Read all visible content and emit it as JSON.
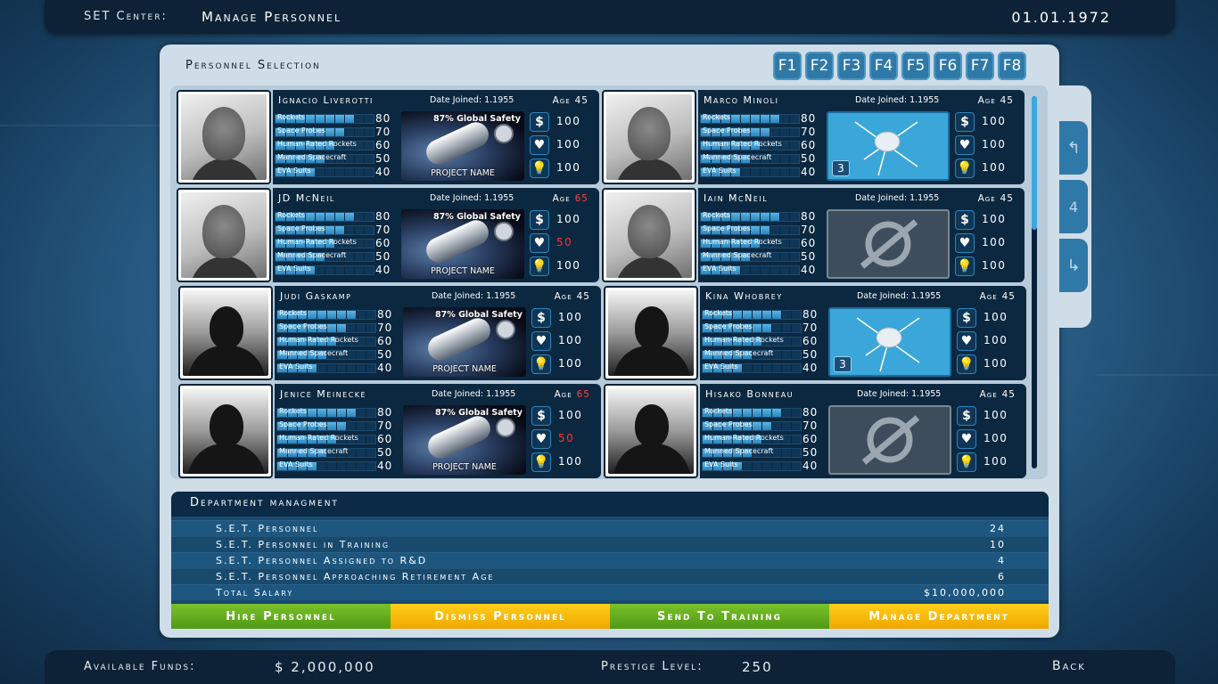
{
  "topbar": {
    "label": "SET Center:",
    "title": "Manage Personnel",
    "date": "01.01.1972"
  },
  "panel": {
    "title": "Personnel Selection",
    "fkeys": [
      "F1",
      "F2",
      "F3",
      "F4",
      "F5",
      "F6",
      "F7",
      "F8"
    ]
  },
  "pager": {
    "up": "↰",
    "page": "4",
    "down": "↳"
  },
  "skill_labels": [
    "Rockets",
    "Space Probes",
    "Human-Rated Rockets",
    "Manned Spacecraft",
    "EVA Suits"
  ],
  "date_label": "Date Joined:",
  "age_label": "Age",
  "personnel": [
    {
      "name": "Ignacio Liverotti",
      "date_joined": "1.1955",
      "age": "45",
      "age_alert": false,
      "photo": "real",
      "skills": [
        {
          "label": "Rockets",
          "value": "80",
          "level": 0.8
        },
        {
          "label": "Space Probes",
          "value": "70",
          "level": 0.7
        },
        {
          "label": "Human-Rated Rockets",
          "value": "60",
          "level": 0.6
        },
        {
          "label": "Manned Spacecraft",
          "value": "50",
          "level": 0.5
        },
        {
          "label": "EVA Suits",
          "value": "40",
          "level": 0.4
        }
      ],
      "project": {
        "kind": "rocket",
        "safety": "87% Global Safety",
        "name": "PROJECT NAME"
      },
      "salary": "100",
      "health": "100",
      "health_alert": false,
      "ideas": "100"
    },
    {
      "name": "Marco Minoli",
      "date_joined": "1.1955",
      "age": "45",
      "age_alert": false,
      "photo": "real",
      "skills": [
        {
          "label": "Rockets",
          "value": "80",
          "level": 0.8
        },
        {
          "label": "Space Probes",
          "value": "70",
          "level": 0.7
        },
        {
          "label": "Human-Rated Rockets",
          "value": "60",
          "level": 0.6
        },
        {
          "label": "Manned Spacecraft",
          "value": "50",
          "level": 0.5
        },
        {
          "label": "EVA Suits",
          "value": "40",
          "level": 0.4
        }
      ],
      "project": {
        "kind": "probe",
        "badge": "3"
      },
      "salary": "100",
      "health": "100",
      "health_alert": false,
      "ideas": "100"
    },
    {
      "name": "JD McNeil",
      "date_joined": "1.1955",
      "age": "65",
      "age_alert": true,
      "photo": "real",
      "skills": [
        {
          "label": "Rockets",
          "value": "80",
          "level": 0.8
        },
        {
          "label": "Space Probes",
          "value": "70",
          "level": 0.7
        },
        {
          "label": "Human-Rated Rockets",
          "value": "60",
          "level": 0.6
        },
        {
          "label": "Manned Spacecraft",
          "value": "50",
          "level": 0.5
        },
        {
          "label": "EVA Suits",
          "value": "40",
          "level": 0.4
        }
      ],
      "project": {
        "kind": "rocket",
        "safety": "87% Global Safety",
        "name": "PROJECT NAME"
      },
      "salary": "100",
      "health": "50",
      "health_alert": true,
      "ideas": "100"
    },
    {
      "name": "Iain McNeil",
      "date_joined": "1.1955",
      "age": "45",
      "age_alert": false,
      "photo": "real",
      "skills": [
        {
          "label": "Rockets",
          "value": "80",
          "level": 0.8
        },
        {
          "label": "Space Probes",
          "value": "70",
          "level": 0.7
        },
        {
          "label": "Human-Rated Rockets",
          "value": "60",
          "level": 0.6
        },
        {
          "label": "Manned Spacecraft",
          "value": "50",
          "level": 0.5
        },
        {
          "label": "EVA Suits",
          "value": "40",
          "level": 0.4
        }
      ],
      "project": {
        "kind": "empty"
      },
      "salary": "100",
      "health": "100",
      "health_alert": false,
      "ideas": "100"
    },
    {
      "name": "Judi Gaskamp",
      "date_joined": "1.1955",
      "age": "45",
      "age_alert": false,
      "photo": "silhouette",
      "skills": [
        {
          "label": "Rockets",
          "value": "80",
          "level": 0.8
        },
        {
          "label": "Space Probes",
          "value": "70",
          "level": 0.7
        },
        {
          "label": "Human-Rated Rockets",
          "value": "60",
          "level": 0.6
        },
        {
          "label": "Manned Spacecraft",
          "value": "50",
          "level": 0.5
        },
        {
          "label": "EVA Suits",
          "value": "40",
          "level": 0.4
        }
      ],
      "project": {
        "kind": "rocket",
        "safety": "87% Global Safety",
        "name": "PROJECT NAME"
      },
      "salary": "100",
      "health": "100",
      "health_alert": false,
      "ideas": "100"
    },
    {
      "name": "Kina Whobrey",
      "date_joined": "1.1955",
      "age": "45",
      "age_alert": false,
      "photo": "silhouette",
      "skills": [
        {
          "label": "Rockets",
          "value": "80",
          "level": 0.8
        },
        {
          "label": "Space Probes",
          "value": "70",
          "level": 0.7
        },
        {
          "label": "Human-Rated Rockets",
          "value": "60",
          "level": 0.6
        },
        {
          "label": "Manned Spacecraft",
          "value": "50",
          "level": 0.5
        },
        {
          "label": "EVA Suits",
          "value": "40",
          "level": 0.4
        }
      ],
      "project": {
        "kind": "probe",
        "badge": "3"
      },
      "salary": "100",
      "health": "100",
      "health_alert": false,
      "ideas": "100"
    },
    {
      "name": "Jenice Meinecke",
      "date_joined": "1.1955",
      "age": "65",
      "age_alert": true,
      "photo": "silhouette",
      "skills": [
        {
          "label": "Rockets",
          "value": "80",
          "level": 0.8
        },
        {
          "label": "Space Probes",
          "value": "70",
          "level": 0.7
        },
        {
          "label": "Human-Rated Rockets",
          "value": "60",
          "level": 0.6
        },
        {
          "label": "Manned Spacecraft",
          "value": "50",
          "level": 0.5
        },
        {
          "label": "EVA Suits",
          "value": "40",
          "level": 0.4
        }
      ],
      "project": {
        "kind": "rocket",
        "safety": "87% Global Safety",
        "name": "PROJECT NAME"
      },
      "salary": "100",
      "health": "50",
      "health_alert": true,
      "ideas": "100"
    },
    {
      "name": "Hisako Bonneau",
      "date_joined": "1.1955",
      "age": "45",
      "age_alert": false,
      "photo": "silhouette",
      "skills": [
        {
          "label": "Rockets",
          "value": "80",
          "level": 0.8
        },
        {
          "label": "Space Probes",
          "value": "70",
          "level": 0.7
        },
        {
          "label": "Human-Rated Rockets",
          "value": "60",
          "level": 0.6
        },
        {
          "label": "Manned Spacecraft",
          "value": "50",
          "level": 0.5
        },
        {
          "label": "EVA Suits",
          "value": "40",
          "level": 0.4
        }
      ],
      "project": {
        "kind": "empty"
      },
      "salary": "100",
      "health": "100",
      "health_alert": false,
      "ideas": "100"
    }
  ],
  "stat_icons": [
    "dollar-icon",
    "heart-icon",
    "lightbulb-icon"
  ],
  "colors": {
    "alert": "#ff3030",
    "button_green": "#6cb523",
    "button_yellow": "#ffc107",
    "panel_dark": "#0b2840"
  },
  "department": {
    "title": "Department managment",
    "rows": [
      {
        "label": "S.E.T. Personnel",
        "value": "24"
      },
      {
        "label": "S.E.T. Personnel in Training",
        "value": "10"
      },
      {
        "label": "S.E.T. Personnel Assigned to R&D",
        "value": "4"
      },
      {
        "label": "S.E.T. Personnel Approaching Retirement Age",
        "value": "6"
      },
      {
        "label": "Total Salary",
        "value": "$10,000,000"
      }
    ]
  },
  "actions": {
    "hire": "Hire Personnel",
    "dismiss": "Dismiss Personnel",
    "training": "Send To Training",
    "manage": "Manage Department"
  },
  "bottombar": {
    "funds_label": "Available Funds:",
    "funds_value": "$ 2,000,000",
    "prestige_label": "Prestige Level:",
    "prestige_value": "250",
    "back": "Back"
  }
}
